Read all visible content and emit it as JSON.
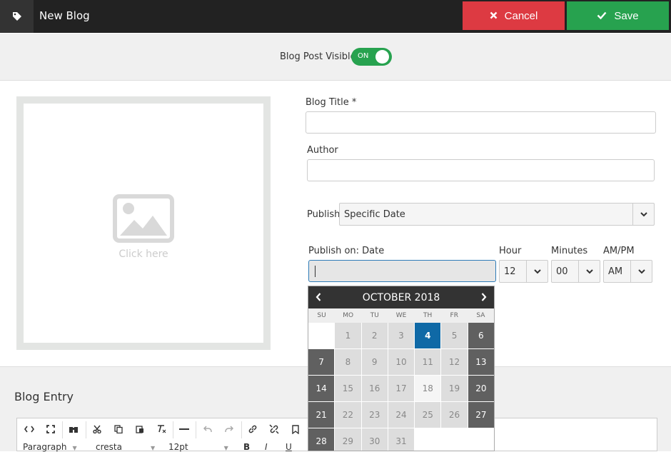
{
  "header": {
    "title": "New Blog",
    "cancel_label": "Cancel",
    "save_label": "Save"
  },
  "visibility": {
    "label": "Blog Post Visible",
    "toggle_label": "ON",
    "on": true
  },
  "image": {
    "placeholder": "Click here"
  },
  "form": {
    "blog_title_label": "Blog Title *",
    "author_label": "Author",
    "publish_label": "Publish",
    "publish_value": "Specific Date",
    "publish_on_label": "Publish on: Date",
    "hour_label": "Hour",
    "hour_value": "12",
    "minutes_label": "Minutes",
    "minutes_value": "00",
    "ampm_label": "AM/PM",
    "ampm_value": "AM"
  },
  "calendar": {
    "month_label": "OCTOBER 2018",
    "weekdays": [
      "SU",
      "MO",
      "TU",
      "WE",
      "TH",
      "FR",
      "SA"
    ],
    "selected_day": 4,
    "days": [
      [
        "",
        "1",
        "2",
        "3",
        "4",
        "5",
        "6"
      ],
      [
        "7",
        "8",
        "9",
        "10",
        "11",
        "12",
        "13"
      ],
      [
        "14",
        "15",
        "16",
        "17",
        "18",
        "19",
        "20"
      ],
      [
        "21",
        "22",
        "23",
        "24",
        "25",
        "26",
        "27"
      ],
      [
        "28",
        "29",
        "30",
        "31",
        "",
        "",
        ""
      ]
    ]
  },
  "editor": {
    "section_label": "Blog Entry",
    "format_value": "Paragraph",
    "font_value": "cresta",
    "size_value": "12pt",
    "bold": "B",
    "italic": "I",
    "underline": "U"
  },
  "colors": {
    "cancel": "#dd3a42",
    "save": "#27a24f",
    "today": "#0f69a6",
    "topbar": "#222222"
  }
}
